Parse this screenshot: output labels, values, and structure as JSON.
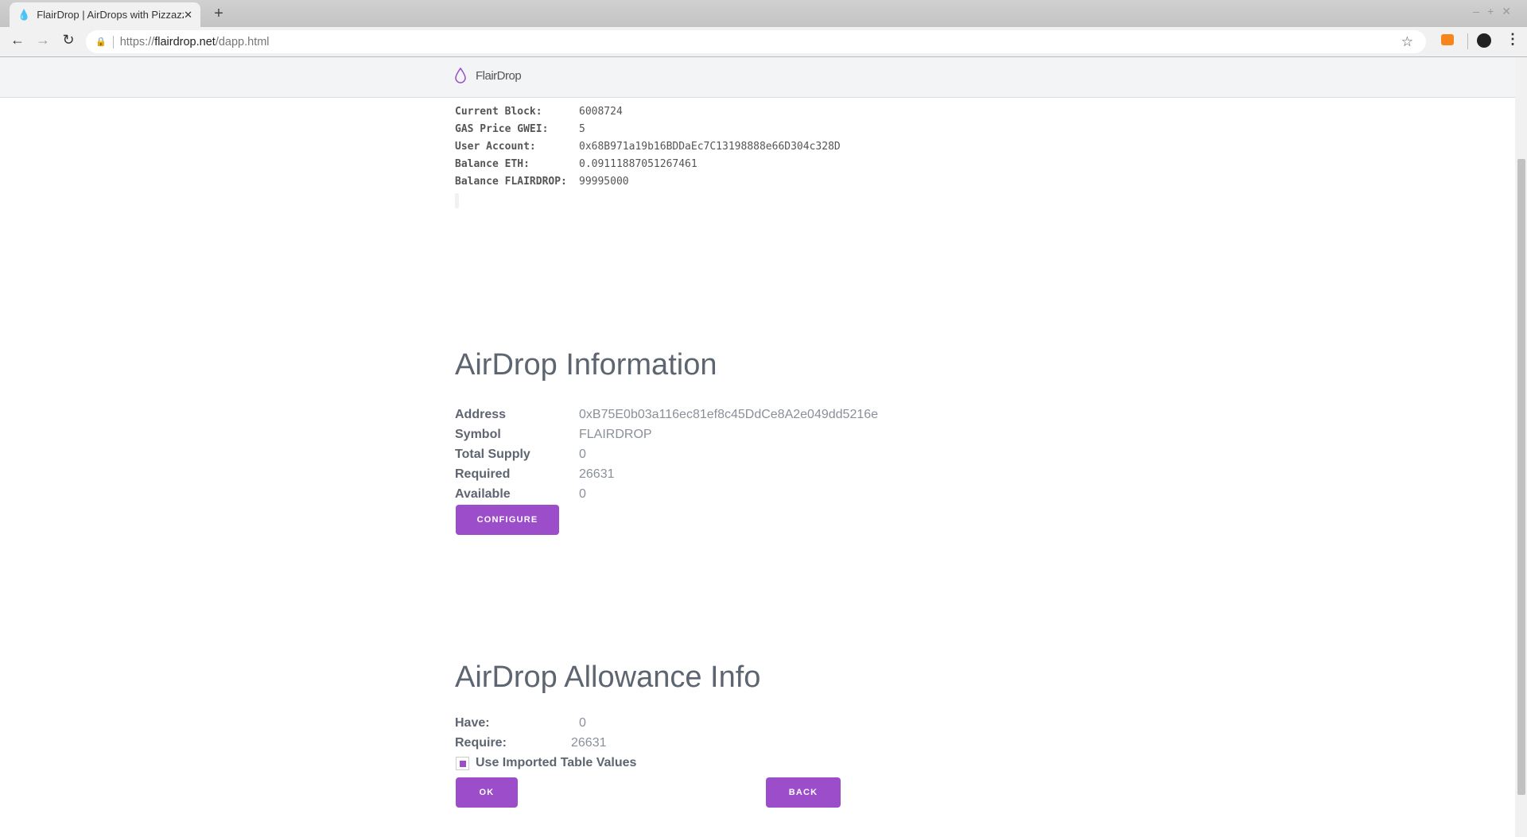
{
  "browser": {
    "tab_title": "FlairDrop | AirDrops with Pizzazz",
    "new_tab": "+",
    "url_scheme": "https://",
    "url_domain": "flairdrop.net",
    "url_path": "/dapp.html"
  },
  "header": {
    "brand": "FlairDrop",
    "accent": "#9b4dca"
  },
  "account_info": [
    {
      "label": "Current Block:",
      "value": "6008724"
    },
    {
      "label": "GAS Price GWEI:",
      "value": "5"
    },
    {
      "label": "User Account:",
      "value": "0x68B971a19b16BDDaEc7C13198888e66D304c328D"
    },
    {
      "label": "Balance ETH:",
      "value": "0.09111887051267461"
    },
    {
      "label": "Balance FLAIRDROP:",
      "value": "99995000"
    }
  ],
  "airdrop_info": {
    "title": "AirDrop Information",
    "rows": [
      {
        "label": "Address",
        "value": "0xB75E0b03a116ec81ef8c45DdCe8A2e049dd5216e"
      },
      {
        "label": "Symbol",
        "value": "FLAIRDROP"
      },
      {
        "label": "Total Supply",
        "value": "0"
      },
      {
        "label": "Required",
        "value": "26631"
      },
      {
        "label": "Available",
        "value": "0"
      }
    ],
    "configure_label": "CONFIGURE"
  },
  "allowance": {
    "title": "AirDrop Allowance Info",
    "have_label": "Have:",
    "have_value": "0",
    "require_label": "Require:",
    "require_value": "26631",
    "checkbox_label": "Use Imported Table Values",
    "checkbox_checked": true,
    "ok_label": "OK",
    "back_label": "BACK"
  }
}
